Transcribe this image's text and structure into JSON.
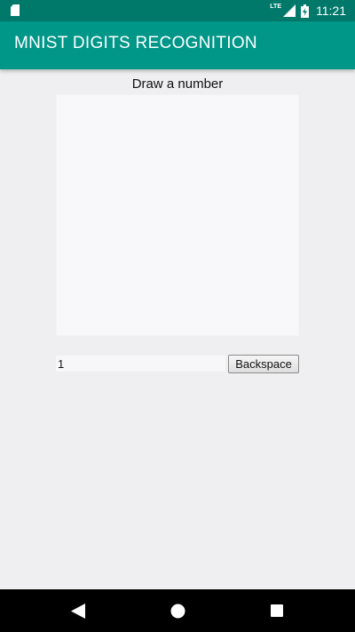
{
  "status_bar": {
    "network_label": "LTE",
    "time": "11:21",
    "icons": [
      "sd-card-icon",
      "signal-icon",
      "battery-charging-icon"
    ]
  },
  "app_bar": {
    "title": "MNIST DIGITS RECOGNITION",
    "background_color": "#009688",
    "status_bar_color": "#00796b"
  },
  "main": {
    "prompt": "Draw a number",
    "recognized_input": {
      "value": "1",
      "placeholder": ""
    },
    "backspace_label": "Backspace"
  },
  "nav_bar": {
    "icons": [
      "back-icon",
      "home-icon",
      "recents-icon"
    ]
  }
}
